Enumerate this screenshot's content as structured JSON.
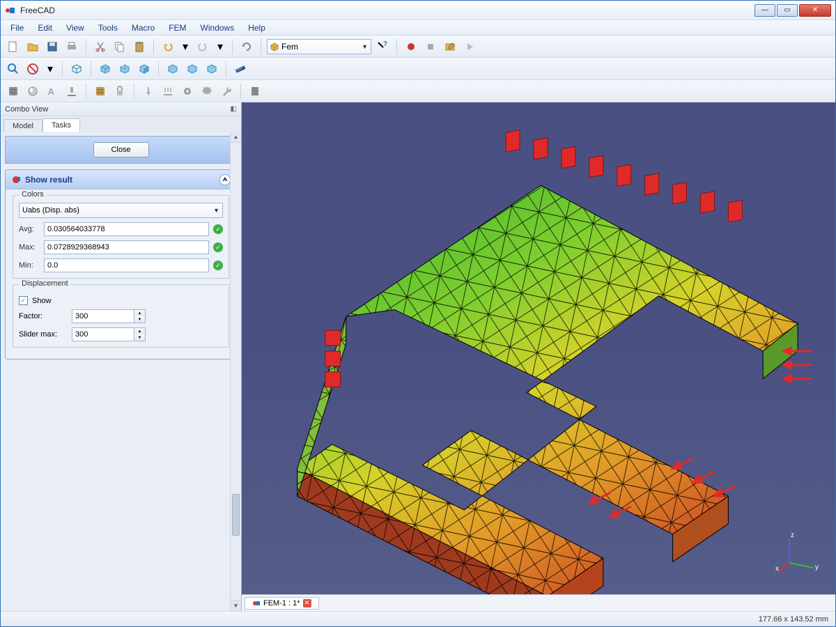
{
  "window": {
    "title": "FreeCAD"
  },
  "menubar": [
    "File",
    "Edit",
    "View",
    "Tools",
    "Macro",
    "FEM",
    "Windows",
    "Help"
  ],
  "toolbar": {
    "workbench": "Fem"
  },
  "combo": {
    "header": "Combo View",
    "tabs": {
      "model": "Model",
      "tasks": "Tasks"
    },
    "close_btn": "Close"
  },
  "task": {
    "title": "Show result",
    "colors_group": "Colors",
    "color_mode": "Uabs (Disp. abs)",
    "avg_label": "Avg:",
    "avg_value": "0.030564033778",
    "max_label": "Max:",
    "max_value": "0.0728929368943",
    "min_label": "Min:",
    "min_value": "0.0",
    "disp_group": "Displacement",
    "show_label": "Show",
    "factor_label": "Factor:",
    "factor_value": "300",
    "slidermax_label": "Slider max:",
    "slidermax_value": "300"
  },
  "doc_tab": "FEM-1 : 1*",
  "statusbar": "177.66 x 143.52 mm",
  "triad": {
    "x": "x",
    "y": "y",
    "z": "z"
  }
}
